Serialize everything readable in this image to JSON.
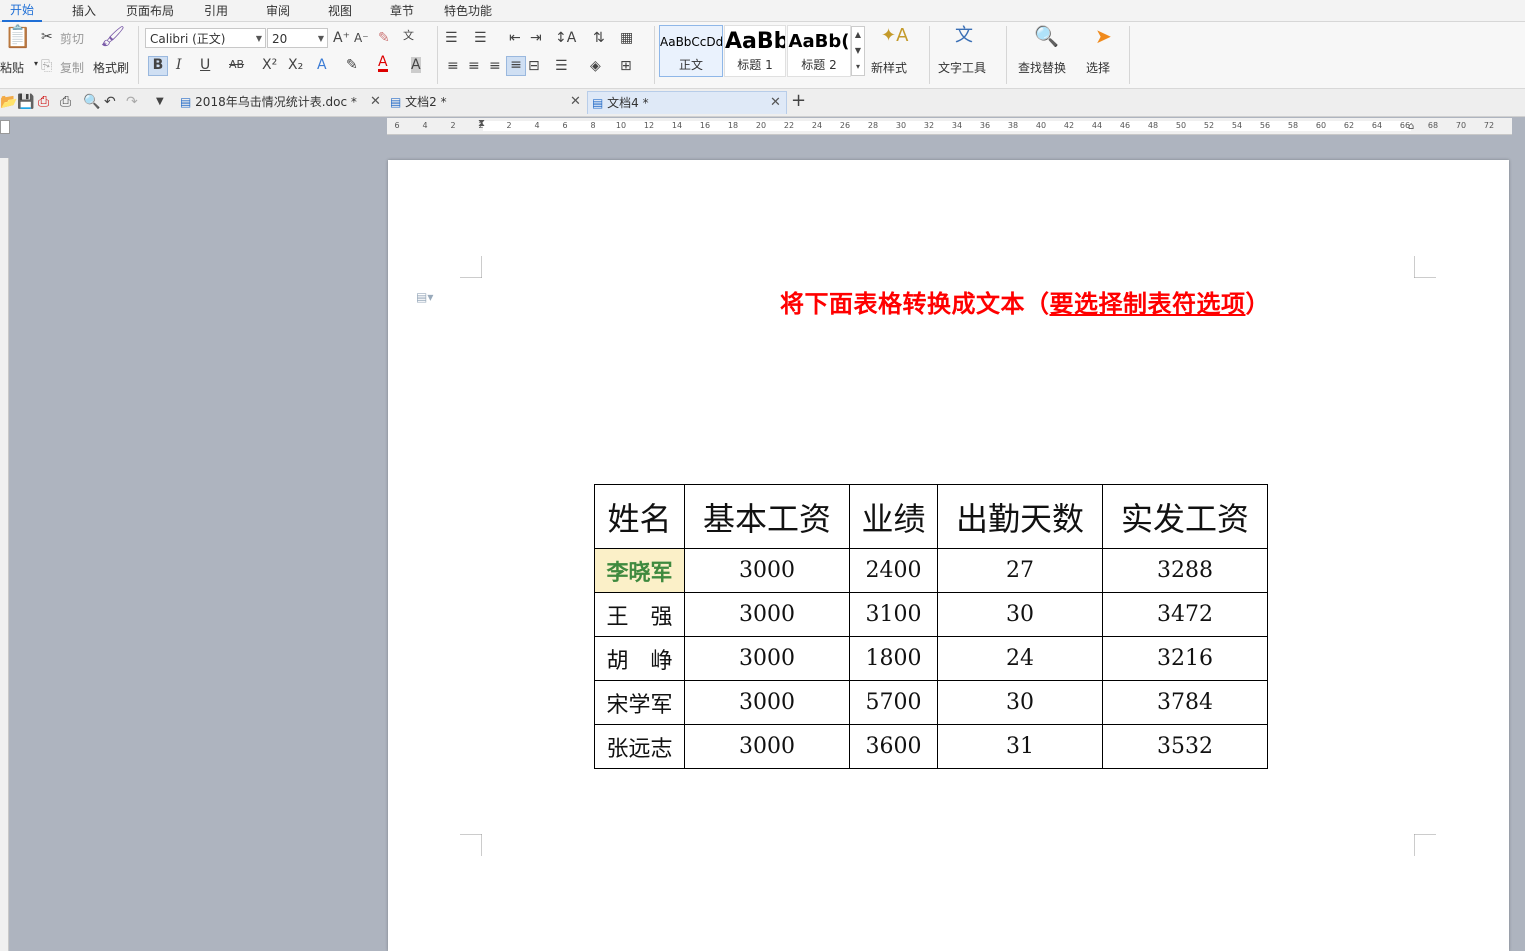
{
  "menu": {
    "tabs": [
      "开始",
      "插入",
      "页面布局",
      "引用",
      "审阅",
      "视图",
      "章节",
      "特色功能"
    ],
    "active": "开始"
  },
  "ribbon": {
    "paste": "粘贴",
    "cut": "剪切",
    "copy": "复制",
    "format_painter": "格式刷",
    "font_name": "Calibri (正文)",
    "font_size": "20",
    "styles": [
      {
        "sample": "AaBbCcDd",
        "name": "正文"
      },
      {
        "sample": "AaBb",
        "name": "标题 1"
      },
      {
        "sample": "AaBb(",
        "name": "标题 2"
      }
    ],
    "new_style": "新样式",
    "text_tools": "文字工具",
    "find_replace": "查找替换",
    "select": "选择"
  },
  "doc_tabs": [
    {
      "title": "2018年乌击情况统计表.doc *"
    },
    {
      "title": "文档2 *"
    },
    {
      "title": "文档4 *"
    }
  ],
  "ruler": {
    "labels": [
      "6",
      "4",
      "2",
      "2",
      "2",
      "4",
      "6",
      "8",
      "10",
      "12",
      "14",
      "16",
      "18",
      "20",
      "22",
      "24",
      "26",
      "28",
      "30",
      "32",
      "34",
      "36",
      "38",
      "40",
      "42",
      "44",
      "46",
      "48",
      "50",
      "52",
      "54",
      "56",
      "58",
      "60",
      "62",
      "64",
      "66",
      "68",
      "70",
      "72"
    ]
  },
  "document": {
    "title_main": "将下面表格转换成文本（",
    "title_underlined": "要选择制表符选项",
    "title_end": "）",
    "table": {
      "headers": [
        "姓名",
        "基本工资",
        "业绩",
        "出勤天数",
        "实发工资"
      ],
      "rows": [
        [
          "李晓军",
          "3000",
          "2400",
          "27",
          "3288"
        ],
        [
          "王　强",
          "3000",
          "3100",
          "30",
          "3472"
        ],
        [
          "胡　峥",
          "3000",
          "1800",
          "24",
          "3216"
        ],
        [
          "宋学军",
          "3000",
          "5700",
          "30",
          "3784"
        ],
        [
          "张远志",
          "3000",
          "3600",
          "31",
          "3532"
        ]
      ]
    }
  },
  "colors": {
    "accent": "#1f6fd6",
    "title_red": "#ff0000",
    "highlight_bg": "#fbf0c8",
    "highlight_text": "#3f8a3f"
  }
}
